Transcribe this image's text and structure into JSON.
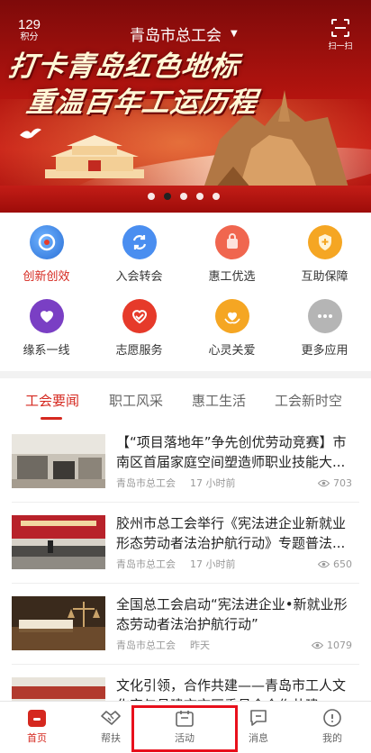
{
  "header": {
    "points_value": "129",
    "points_label": "积分",
    "city": "青岛市总工会",
    "scan_label": "扫一扫"
  },
  "banner": {
    "line1": "打卡青岛红色地标",
    "line2": "重温百年工运历程",
    "slide_count": 5,
    "active_slide": 2
  },
  "features": [
    {
      "label": "创新创效",
      "icon": "innovation-icon",
      "color": "#3d7be8",
      "highlight": true
    },
    {
      "label": "入会转会",
      "icon": "transfer-icon",
      "color": "#4a8ef0"
    },
    {
      "label": "惠工优选",
      "icon": "shopping-bag-icon",
      "color": "#f0664f"
    },
    {
      "label": "互助保障",
      "icon": "shield-plus-icon",
      "color": "#f5a623"
    },
    {
      "label": "缘系一线",
      "icon": "heart-icon",
      "color": "#7a3fc4"
    },
    {
      "label": "志愿服务",
      "icon": "volunteer-heart-icon",
      "color": "#e63a2a"
    },
    {
      "label": "心灵关爱",
      "icon": "care-hands-icon",
      "color": "#f5a623"
    },
    {
      "label": "更多应用",
      "icon": "more-icon",
      "color": "#b5b5b5"
    }
  ],
  "tabs": [
    "工会要闻",
    "职工风采",
    "惠工生活",
    "工会新时空"
  ],
  "active_tab": 0,
  "news": [
    {
      "title": "【“项目落地年”争先创优劳动竞赛】市南区首届家庭空间塑造师职业技能大...",
      "source": "青岛市总工会",
      "time": "17 小时前",
      "views": "703"
    },
    {
      "title": "胶州市总工会举行《宪法进企业新就业形态劳动者法治护航行动》专题普法...",
      "source": "青岛市总工会",
      "time": "17 小时前",
      "views": "650"
    },
    {
      "title": "全国总工会启动“宪法进企业•新就业形态劳动者法治护航行动”",
      "source": "青岛市总工会",
      "time": "昨天",
      "views": "1079"
    },
    {
      "title": "文化引领，合作共建——青岛市工人文化宫与昌建市市区委员会合作共建...",
      "source": "",
      "time": "",
      "views": ""
    }
  ],
  "bottom_nav": [
    {
      "label": "首页",
      "icon": "home-icon",
      "active": true
    },
    {
      "label": "帮扶",
      "icon": "handshake-icon"
    },
    {
      "label": "活动",
      "icon": "activity-icon"
    },
    {
      "label": "消息",
      "icon": "message-icon"
    },
    {
      "label": "我的",
      "icon": "profile-icon"
    }
  ],
  "colors": {
    "accent": "#d5281f",
    "highlight_box": "#e8101c"
  }
}
